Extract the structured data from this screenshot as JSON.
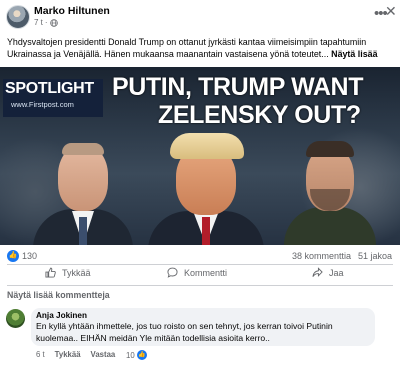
{
  "post": {
    "author": "Marko Hiltunen",
    "time": "7 t",
    "meta_sep": "·",
    "text": "Yhdysvaltojen  presidentti Donald Trump on ottanut jyrkästi kantaa viimeisimpiin tapahtumiin Ukrainassa ja Venäjällä. Hänen mukaansa maanantain vastaisena yönä toteutet...",
    "see_more": "Näytä lisää"
  },
  "image": {
    "logo_word": "SPOTLIGHT",
    "logo_site": "www.Firstpost.com",
    "headline_line1": "PUTIN, TRUMP WANT",
    "headline_line2": "ZELENSKY OUT?"
  },
  "stats": {
    "reactions": "130",
    "comments": "38 kommenttia",
    "shares": "51 jakoa"
  },
  "actions": {
    "like": "Tykkää",
    "comment": "Kommentti",
    "share": "Jaa"
  },
  "more_comments": "Näytä lisää kommentteja",
  "comment": {
    "author": "Anja Jokinen",
    "text": "En kyllä yhtään ihmettele, jos tuo roisto on sen tehnyt, jos kerran toivoi Putinin kuolemaa.. EIHÄN meidän Yle mitään todellisia asioita kerro..",
    "time": "6 t",
    "like": "Tykkää",
    "reply": "Vastaa",
    "likes": "10"
  },
  "colors": {
    "accent": "#1877f2",
    "muted_text": "#65676b",
    "comment_bg": "#f0f2f5"
  },
  "icons": [
    "globe-icon",
    "more-options-icon",
    "close-icon",
    "like-reaction-icon",
    "thumbs-up-icon",
    "comment-icon",
    "share-icon"
  ]
}
